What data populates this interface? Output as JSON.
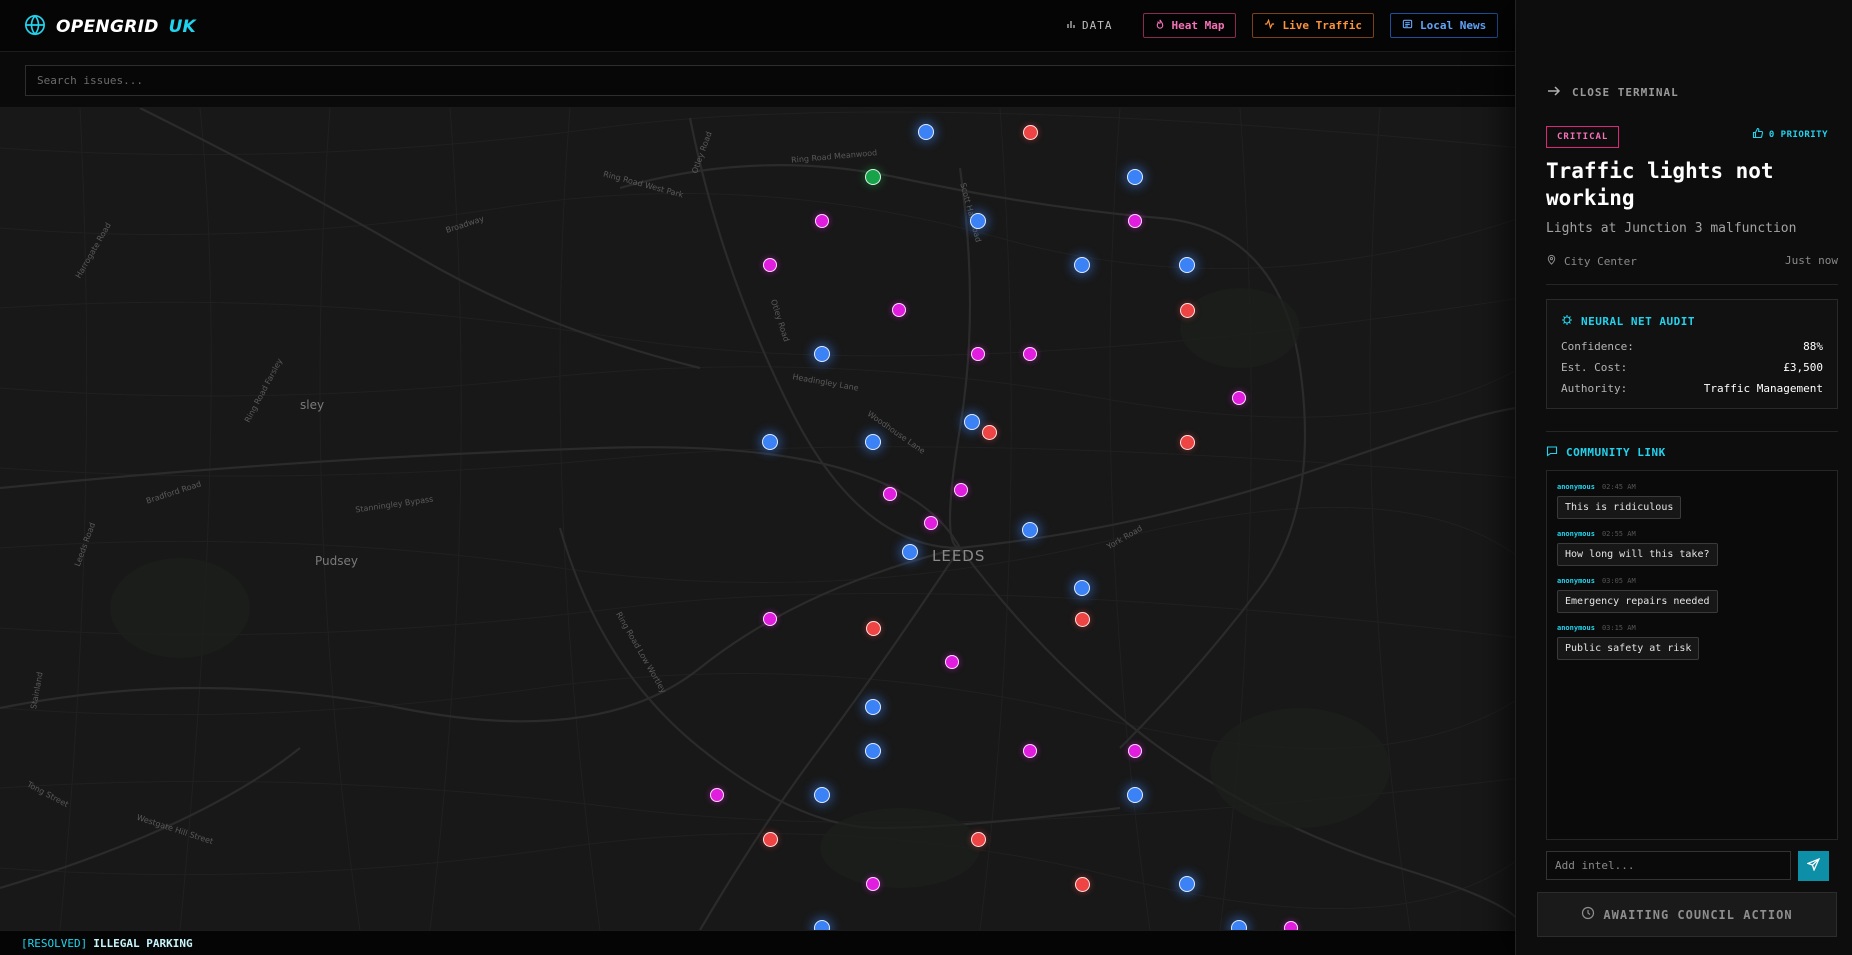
{
  "brand": {
    "name": "OPENGRID",
    "accent": "UK"
  },
  "nav": {
    "data_label": "DATA",
    "heat_map": "Heat Map",
    "live_traffic": "Live Traffic",
    "local_news": "Local News"
  },
  "search": {
    "placeholder": "Search issues..."
  },
  "map": {
    "labels": {
      "city": "LEEDS",
      "town_pudsey": "Pudsey",
      "town_sley": "sley"
    },
    "roads": [
      "Ring Road Meanwood",
      "Ring Road West Park",
      "Broadway",
      "Otley Road",
      "Scott Hall Road",
      "Headingley Lane",
      "Woodhouse Lane",
      "Stanningley Bypass",
      "Bradford Road",
      "Leeds Road",
      "Ring Road Low Wortley",
      "York Road",
      "Tong Street",
      "Westgate Hill Street",
      "Harrogate Road",
      "Ring Road Farsley",
      "Stainland",
      "Otley Road"
    ],
    "pin_colors": {
      "blue": "#3b82f6",
      "magenta": "#e11de0",
      "red": "#ef4444",
      "green": "#16a34a"
    }
  },
  "ticker": {
    "status": "[RESOLVED]",
    "text": "ILLEGAL PARKING"
  },
  "panel": {
    "close_label": "CLOSE TERMINAL",
    "severity": "CRITICAL",
    "priority": "0 PRIORITY",
    "title": "Traffic lights not working",
    "description": "Lights at Junction 3 malfunction",
    "location": "City Center",
    "time": "Just now",
    "audit": {
      "heading": "NEURAL NET AUDIT",
      "rows": [
        {
          "key": "Confidence:",
          "value": "88%"
        },
        {
          "key": "Est. Cost:",
          "value": "£3,500"
        },
        {
          "key": "Authority:",
          "value": "Traffic Management"
        }
      ]
    },
    "community": {
      "heading": "COMMUNITY LINK",
      "messages": [
        {
          "user": "anonymous",
          "time": "02:45 AM",
          "text": "This is ridiculous"
        },
        {
          "user": "anonymous",
          "time": "02:55 AM",
          "text": "How long will this take?"
        },
        {
          "user": "anonymous",
          "time": "03:05 AM",
          "text": "Emergency repairs needed"
        },
        {
          "user": "anonymous",
          "time": "03:15 AM",
          "text": "Public safety at risk"
        }
      ],
      "input_placeholder": "Add intel..."
    },
    "status_button": "AWAITING COUNCIL ACTION"
  }
}
